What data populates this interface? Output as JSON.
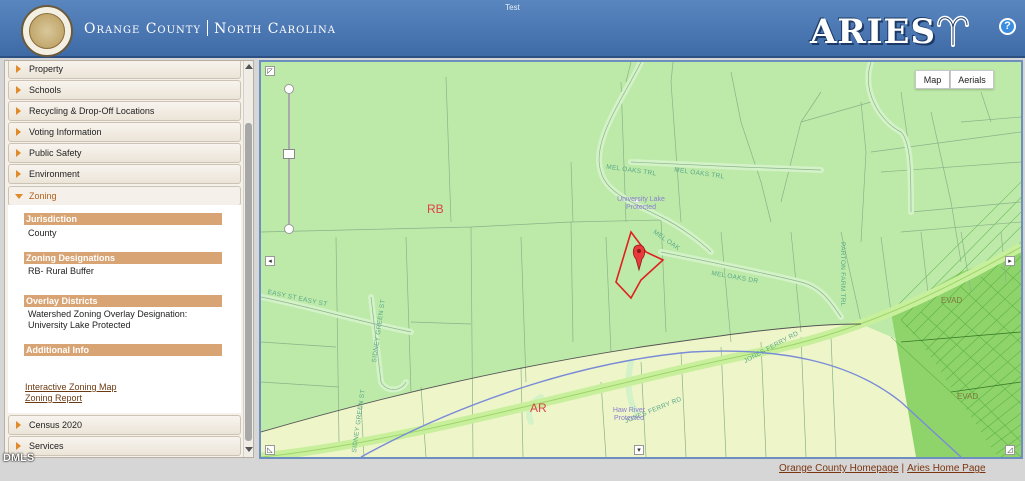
{
  "window": {
    "title": "Test"
  },
  "header": {
    "county": "Orange County",
    "state": "North Carolina",
    "app_name": "ARIES",
    "help_label": "?"
  },
  "sidebar": {
    "sections": [
      {
        "label": "Property",
        "expanded": false
      },
      {
        "label": "Schools",
        "expanded": false
      },
      {
        "label": "Recycling & Drop-Off Locations",
        "expanded": false
      },
      {
        "label": "Voting Information",
        "expanded": false
      },
      {
        "label": "Public Safety",
        "expanded": false
      },
      {
        "label": "Environment",
        "expanded": false
      },
      {
        "label": "Zoning",
        "expanded": true
      },
      {
        "label": "Census 2020",
        "expanded": false
      },
      {
        "label": "Services",
        "expanded": false
      }
    ],
    "zoning": {
      "jurisdiction_header": "Jurisdiction",
      "jurisdiction_value": "County",
      "designations_header": "Zoning Designations",
      "designations_value": "RB- Rural Buffer",
      "overlay_header": "Overlay Districts",
      "overlay_line1": "Watershed Zoning Overlay Designation:",
      "overlay_line2": "University Lake Protected",
      "additional_header": "Additional Info",
      "link_map": "Interactive Zoning Map",
      "link_report": "Zoning Report"
    }
  },
  "map": {
    "controls": {
      "map_label": "Map",
      "aerials_label": "Aerials",
      "active": "Map"
    },
    "zones": {
      "rb": "RB",
      "ar": "AR",
      "evad1": "EVAD",
      "evad2": "EVAD"
    },
    "streets": {
      "mel_oaks_trl_1": "MEL OAKS TRL",
      "mel_oaks_trl_2": "MEL OAKS TRL",
      "mel_oaks_dr": "MEL OAKS DR",
      "mel_oaks_short": "MEL OAK",
      "parton_farm_trl": "PARTON FARM TRL",
      "easy_st": "EASY ST  EASY ST",
      "sidney_green_st": "SIDNEY GREEN ST",
      "sidney_green_st_2": "SIDNEY GREEN ST",
      "jones_ferry_rd_1": "JONES FERRY RD",
      "jones_ferry_rd_2": "JONES FERRY RD"
    },
    "pois": {
      "university_lake_1": "University Lake",
      "university_lake_2": "Protected",
      "haw_river_1": "Haw River",
      "haw_river_2": "Protected"
    },
    "colors": {
      "rb_fill": "#bdeaa8",
      "ar_fill": "#eef5c8",
      "evad_fill": "#8fd46a",
      "parcel_outline": "#e02020",
      "road": "#c8efbc"
    }
  },
  "footer": {
    "link_county": "Orange County Homepage",
    "separator": "|",
    "link_aries": "Aries Home Page",
    "dmls": "DMLS"
  }
}
